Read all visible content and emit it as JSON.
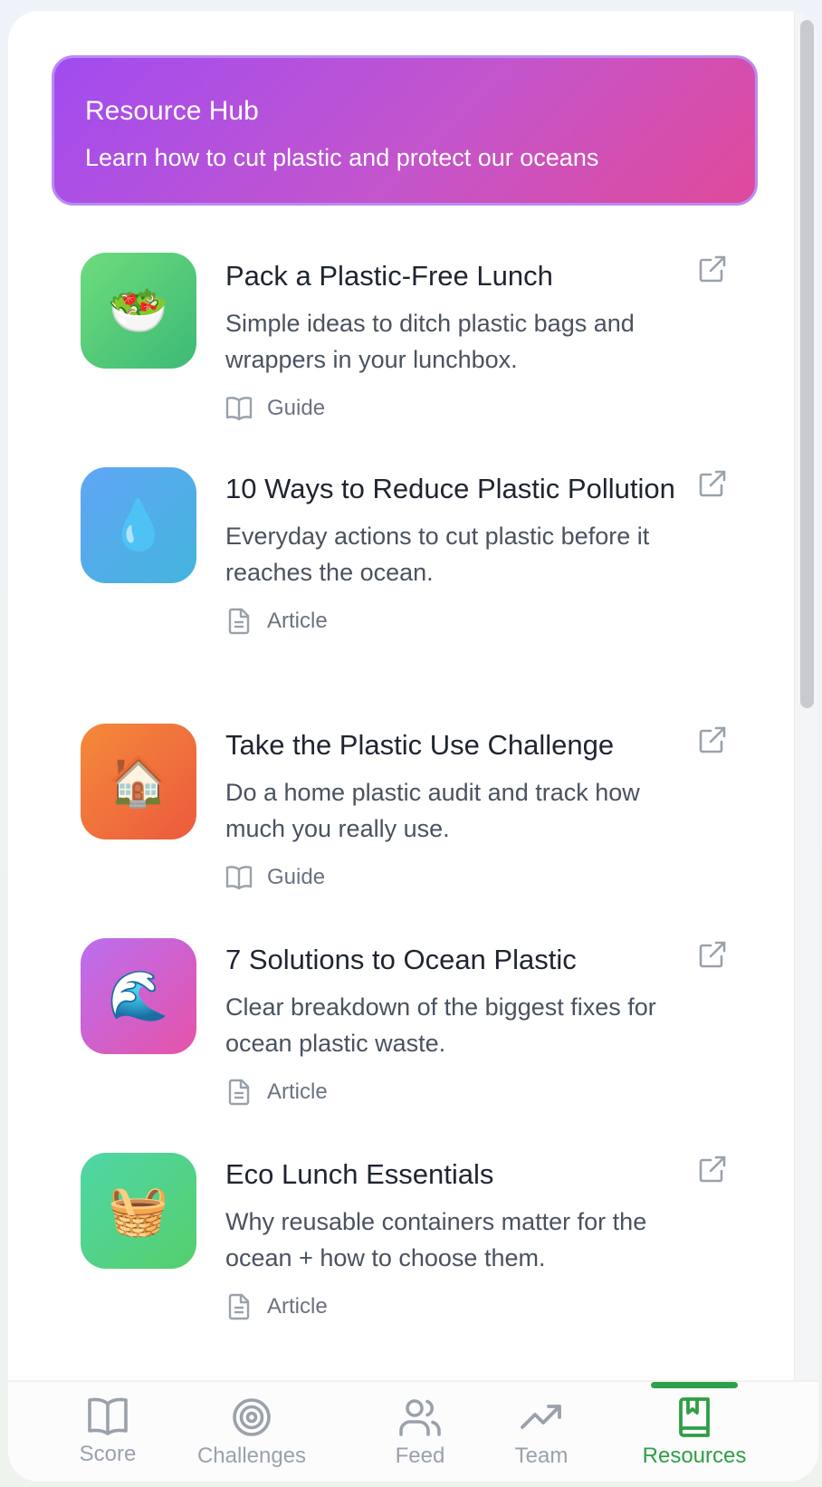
{
  "hub": {
    "title": "Resource Hub",
    "subtitle": "Learn how to cut plastic and protect our oceans"
  },
  "resources": [
    {
      "icon": "🥗",
      "icon_name": "salad-icon",
      "gradient": [
        "#6ddc7c",
        "#3dba76"
      ],
      "title": "Pack a Plastic-Free Lunch",
      "description": "Simple ideas to ditch plastic bags and wrappers in your lunchbox.",
      "type": "Guide",
      "type_icon": "book-icon"
    },
    {
      "icon": "💧",
      "icon_name": "droplet-icon",
      "gradient": [
        "#5fa6f5",
        "#44b4dc"
      ],
      "title": "10 Ways to Reduce Plastic Pollution",
      "description": "Everyday actions to cut plastic before it reaches the ocean.",
      "type": "Article",
      "type_icon": "document-icon"
    },
    {
      "icon": "🏠",
      "icon_name": "house-icon",
      "gradient": [
        "#f48a3a",
        "#ec5a3d"
      ],
      "title": "Take the Plastic Use Challenge",
      "description": "Do a home plastic audit and track how much you really use.",
      "type": "Guide",
      "type_icon": "book-icon"
    },
    {
      "icon": "🌊",
      "icon_name": "wave-icon",
      "gradient": [
        "#bb6ef0",
        "#e653a9"
      ],
      "title": "7 Solutions to Ocean Plastic",
      "description": "Clear breakdown of the biggest fixes for ocean plastic waste.",
      "type": "Article",
      "type_icon": "document-icon"
    },
    {
      "icon": "🧺",
      "icon_name": "basket-icon",
      "gradient": [
        "#4fd6a7",
        "#55cf6c"
      ],
      "title": "Eco Lunch Essentials",
      "description": "Why reusable containers matter for the ocean + how to choose them.",
      "type": "Article",
      "type_icon": "document-icon"
    }
  ],
  "nav": {
    "tabs": [
      {
        "label": "Score",
        "icon": "book-open-icon"
      },
      {
        "label": "Challenges",
        "icon": "target-icon"
      },
      {
        "label": "Feed",
        "icon": "users-icon"
      },
      {
        "label": "Team",
        "icon": "trending-up-icon"
      },
      {
        "label": "Resources",
        "icon": "bookmark-book-icon",
        "active": true
      }
    ],
    "active_color": "#2f9e45",
    "inactive_color": "#9aa1ab"
  }
}
